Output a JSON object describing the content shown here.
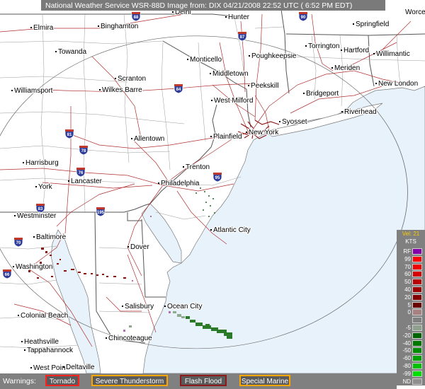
{
  "header": {
    "text": "National Weather Service WSR-88D Image from: DIX 04/21/2008 22:52 UTC ( 6:52 PM EDT)"
  },
  "cities": {
    "delhi": "Delhi",
    "hunter": "Hunter",
    "worcester": "Worcester",
    "elmira": "Elmira",
    "binghamton": "Binghamton",
    "springfield": "Springfield",
    "towanda": "Towanda",
    "monticello": "Monticello",
    "poughkeepsie": "Poughkeepsie",
    "torrington": "Torrington",
    "hartford": "Hartford",
    "willimantic": "Willimantic",
    "middletown": "Middletown",
    "meriden": "Meriden",
    "scranton": "Scranton",
    "new_london": "New London",
    "williamsport": "Williamsport",
    "wilkes_barre": "Wilkes Barre",
    "peekskill": "Peekskill",
    "bridgeport": "Bridgeport",
    "west_milford": "West Milford",
    "riverhead": "Riverhead",
    "syosset": "Syosset",
    "new_york": "New York",
    "allentown": "Allentown",
    "plainfield": "Plainfield",
    "harrisburg": "Harrisburg",
    "trenton": "Trenton",
    "lancaster": "Lancaster",
    "philadelphia": "Philadelphia",
    "york": "York",
    "westminster": "Westminster",
    "atlantic_city": "Atlantic City",
    "baltimore": "Baltimore",
    "dover": "Dover",
    "washington": "Washington",
    "salisbury": "Salisbury",
    "ocean_city": "Ocean City",
    "colonial_beach": "Colonial Beach",
    "chincoteague": "Chincoteague",
    "heathsville": "Heathsville",
    "tappahannock": "Tappahannock",
    "west_point": "West Point",
    "deltaville": "Deltaville"
  },
  "shields": [
    "88",
    "90",
    "87",
    "84",
    "81",
    "78",
    "76",
    "95",
    "83",
    "70",
    "66",
    "195"
  ],
  "legend": {
    "title": "Vel: 21",
    "unit": "KTS",
    "rows": [
      {
        "label": "RF",
        "color": "#8800aa"
      },
      {
        "label": "99",
        "color": "#ff0000"
      },
      {
        "label": "70",
        "color": "#ee0000"
      },
      {
        "label": "60",
        "color": "#d40000"
      },
      {
        "label": "50",
        "color": "#b80000"
      },
      {
        "label": "40",
        "color": "#9c0000"
      },
      {
        "label": "20",
        "color": "#840000"
      },
      {
        "label": "5",
        "color": "#6a0000"
      },
      {
        "label": "0",
        "color": "#a88080"
      },
      {
        "label": "",
        "color": "#808080"
      },
      {
        "label": "-5",
        "color": "#8fa08f"
      },
      {
        "label": "-20",
        "color": "#006400"
      },
      {
        "label": "-40",
        "color": "#007800"
      },
      {
        "label": "-50",
        "color": "#008c00"
      },
      {
        "label": "-60",
        "color": "#00a000"
      },
      {
        "label": "-80",
        "color": "#00c000"
      },
      {
        "label": "-99",
        "color": "#00e000"
      },
      {
        "label": "ND",
        "color": "#909090"
      }
    ]
  },
  "warnings": {
    "label": "Warnings:",
    "items": [
      {
        "label": "Tornado",
        "color": "#ff2020"
      },
      {
        "label": "Severe Thunderstorm",
        "color": "#ffa500"
      },
      {
        "label": "Flash Flood",
        "color": "#8b1a1a"
      },
      {
        "label": "Special Marine",
        "color": "#ffa500"
      }
    ]
  }
}
